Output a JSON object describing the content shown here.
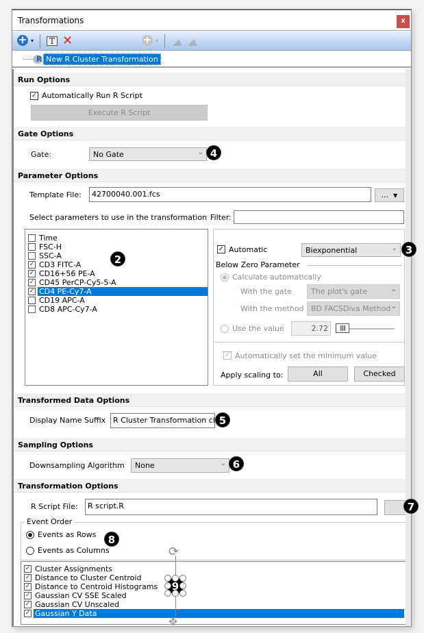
{
  "window": {
    "title": "Transformations",
    "close_label": "x"
  },
  "toolbar": {
    "add_icon": "+",
    "caret": "▾",
    "text_icon": "T",
    "delete_icon": "✕"
  },
  "tree": {
    "item_icon": "R",
    "item_label": "New R Cluster Transformation"
  },
  "run_options": {
    "header": "Run Options",
    "auto_run_label": "Automatically Run R Script",
    "auto_run_checked": true,
    "execute_button": "Execute R Script"
  },
  "gate_options": {
    "header": "Gate Options",
    "gate_label": "Gate:",
    "gate_value": "No Gate"
  },
  "parameter_options": {
    "header": "Parameter Options",
    "template_label": "Template File:",
    "template_value": "42700040.001.fcs",
    "browse_button": "...",
    "browse_caret": "▼",
    "select_label": "Select parameters to use in the transformation",
    "filter_label": "Filter:",
    "filter_value": "",
    "parameters": [
      {
        "label": "Time",
        "checked": false,
        "selected": false
      },
      {
        "label": "FSC-H",
        "checked": false,
        "selected": false
      },
      {
        "label": "SSC-A",
        "checked": false,
        "selected": false
      },
      {
        "label": "CD3 FITC-A",
        "checked": true,
        "selected": false
      },
      {
        "label": "CD16+56 PE-A",
        "checked": true,
        "selected": false
      },
      {
        "label": "CD45 PerCP-Cy5-5-A",
        "checked": true,
        "selected": false
      },
      {
        "label": "CD4 PE-Cy7-A",
        "checked": true,
        "selected": true
      },
      {
        "label": "CD19 APC-A",
        "checked": false,
        "selected": false
      },
      {
        "label": "CD8 APC-Cy7-A",
        "checked": false,
        "selected": false
      }
    ],
    "scaling": {
      "automatic_label": "Automatic",
      "automatic_checked": true,
      "scale_value": "Biexponential",
      "below_zero_title": "Below Zero Parameter",
      "calc_auto_label": "Calculate automatically",
      "with_gate_label": "With the gate",
      "with_gate_value": "The plot's gate",
      "with_method_label": "With the method",
      "with_method_value": "BD FACSDiva Method",
      "use_value_label": "Use the value",
      "use_value": "2.72",
      "auto_min_label": "Automatically set the minimum value",
      "apply_label": "Apply scaling to:",
      "all_button": "All",
      "checked_button": "Checked"
    }
  },
  "transformed_data_options": {
    "header": "Transformed Data Options",
    "suffix_label": "Display Name Suffix",
    "suffix_value": "R Cluster Transformation clus"
  },
  "sampling_options": {
    "header": "Sampling Options",
    "algorithm_label": "Downsampling Algorithm",
    "algorithm_value": "None"
  },
  "transformation_options": {
    "header": "Transformation Options",
    "script_label": "R Script File:",
    "script_value": "R script.R",
    "event_order_title": "Event Order",
    "rows_label": "Events as Rows",
    "columns_label": "Events as Columns",
    "selected_order": "rows",
    "outputs": [
      {
        "label": "Cluster Assignments",
        "checked": true,
        "selected": false
      },
      {
        "label": "Distance to Cluster Centroid",
        "checked": true,
        "selected": false
      },
      {
        "label": "Distance to Centroid Histograms",
        "checked": true,
        "selected": false
      },
      {
        "label": "Gaussian CV SSE Scaled",
        "checked": true,
        "selected": false
      },
      {
        "label": "Gaussian CV Unscaled",
        "checked": true,
        "selected": false
      },
      {
        "label": "Gaussian Y Data",
        "checked": true,
        "selected": true
      }
    ]
  },
  "callouts": [
    "2",
    "3",
    "4",
    "5",
    "6",
    "7",
    "8",
    "9"
  ],
  "glyphs": {
    "check": "✓",
    "chevron": "⌄",
    "rotate": "⟳",
    "move": "✥",
    "slider_thumb": "|||||"
  }
}
